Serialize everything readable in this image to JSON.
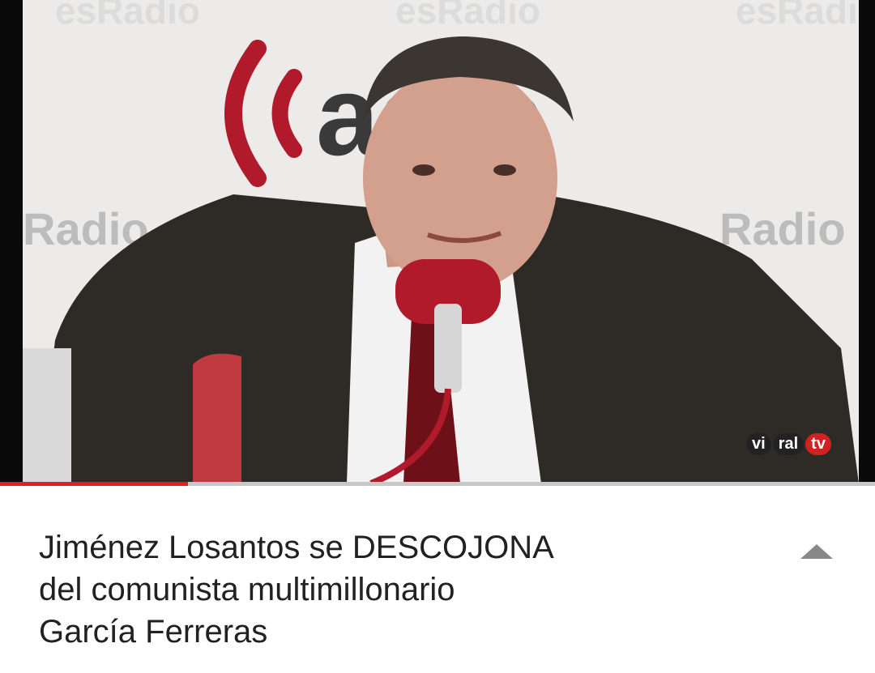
{
  "video": {
    "watermark_brand": "esRadio",
    "studio_logo_text": "adio",
    "studio_side_text": "Radio",
    "channel_bug": {
      "part1": "vi",
      "part2": "ral",
      "part3": "tv"
    },
    "progress_fraction": 0.215
  },
  "details": {
    "title_lines": [
      "Jiménez Losantos se DESCOJONA",
      "del comunista multimillonario",
      "García Ferreras"
    ],
    "expand_icon": "chevron-up-icon"
  },
  "colors": {
    "accent": "#e51e1e",
    "brand_red": "#b01a2a"
  }
}
